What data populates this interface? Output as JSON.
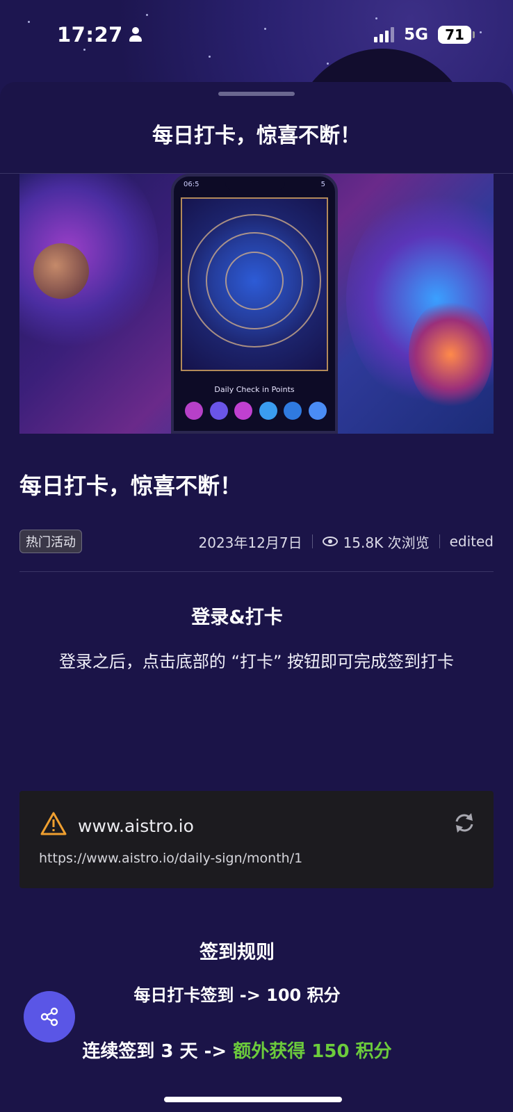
{
  "status_bar": {
    "time": "17:27",
    "network": "5G",
    "battery": "71"
  },
  "sheet": {
    "title": "每日打卡，惊喜不断！"
  },
  "hero": {
    "phone_time": "06:5",
    "phone_battery": "5",
    "phone_label": "Daily Check in Points"
  },
  "article": {
    "title": "每日打卡，惊喜不断！",
    "tag": "热门活动",
    "date": "2023年12月7日",
    "views": "15.8K 次浏览",
    "edited": "edited"
  },
  "login_section": {
    "heading": "登录&打卡",
    "body": "登录之后，点击底部的 “打卡” 按钮即可完成签到打卡"
  },
  "link_card": {
    "domain": "www.aistro.io",
    "url": "https://www.aistro.io/daily-sign/month/1"
  },
  "rules": {
    "heading": "签到规则",
    "line1": "每日打卡签到 -> 100 积分",
    "line2_prefix": "连续签到 3 天 -> ",
    "line2_highlight": "额外获得 150 积分"
  },
  "colors": {
    "background": "#1b1448",
    "accent_green": "#6ccb3c",
    "fab": "#5a56e6",
    "warning": "#f0a030"
  },
  "icons": [
    "person-icon",
    "signal-icon",
    "battery-icon",
    "eye-icon",
    "warning-icon",
    "refresh-icon",
    "share-icon"
  ]
}
